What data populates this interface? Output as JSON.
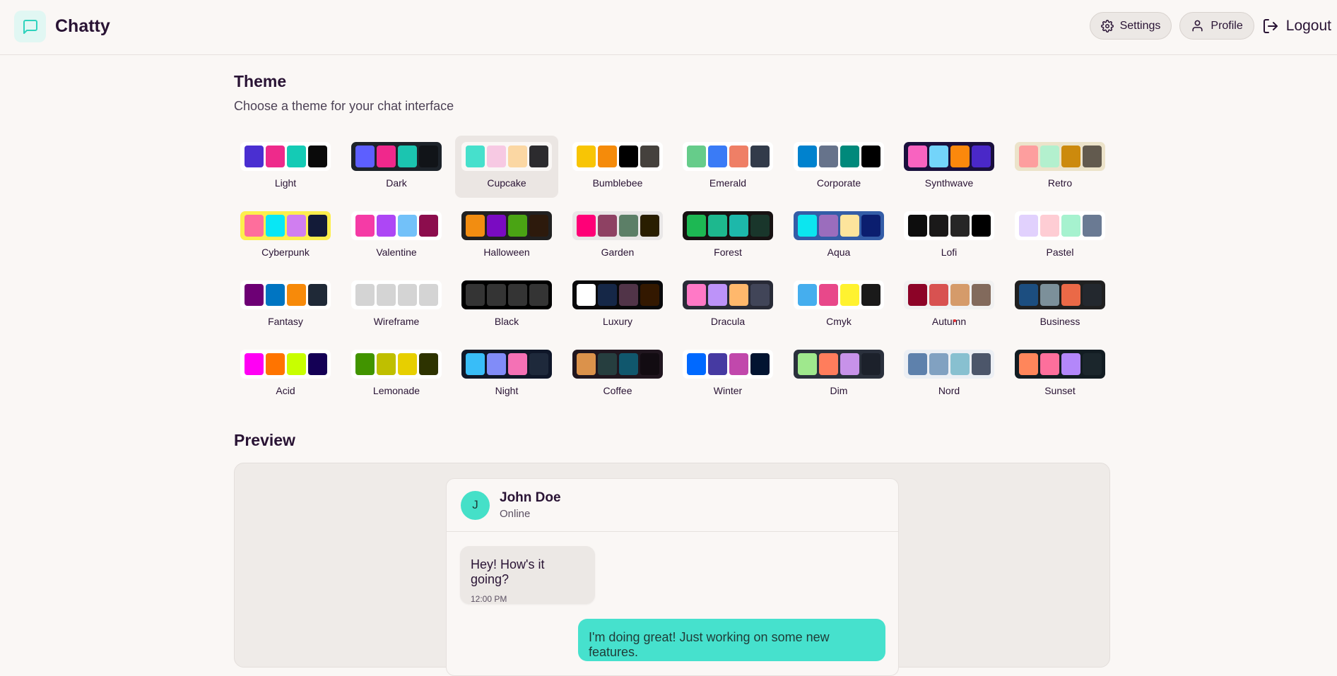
{
  "app": {
    "name": "Chatty"
  },
  "nav": {
    "settings": "Settings",
    "profile": "Profile",
    "logout": "Logout"
  },
  "theme_section": {
    "title": "Theme",
    "subtitle": "Choose a theme for your chat interface"
  },
  "selected_theme": "Cupcake",
  "themes": [
    {
      "name": "Light",
      "bg": "#ffffff",
      "colors": [
        "#4a2fd1",
        "#ee2a8b",
        "#14cbb5",
        "#0a0a0a"
      ]
    },
    {
      "name": "Dark",
      "bg": "#1d232a",
      "colors": [
        "#5d5fff",
        "#f0288c",
        "#1bc5b0",
        "#111418"
      ]
    },
    {
      "name": "Cupcake",
      "bg": "#faf7f5",
      "colors": [
        "#46e0cc",
        "#f7c9e3",
        "#fbd7a3",
        "#2c2b2e"
      ]
    },
    {
      "name": "Bumblebee",
      "bg": "#ffffff",
      "colors": [
        "#f8c505",
        "#f58b0a",
        "#000000",
        "#45413d"
      ]
    },
    {
      "name": "Emerald",
      "bg": "#ffffff",
      "colors": [
        "#66cc8a",
        "#3a7bf6",
        "#ef7f66",
        "#323b4a"
      ]
    },
    {
      "name": "Corporate",
      "bg": "#ffffff",
      "colors": [
        "#0082ce",
        "#66738b",
        "#00897b",
        "#000000"
      ]
    },
    {
      "name": "Synthwave",
      "bg": "#1a103d",
      "colors": [
        "#f863c0",
        "#73d4fa",
        "#fb880c",
        "#4a28c8"
      ]
    },
    {
      "name": "Retro",
      "bg": "#ece3ca",
      "colors": [
        "#fd9e9e",
        "#b3f0ce",
        "#cc8a0d",
        "#625a4e"
      ]
    },
    {
      "name": "Cyberpunk",
      "bg": "#fdef4c",
      "colors": [
        "#fe6e9c",
        "#08e7f5",
        "#d07ef0",
        "#131b38"
      ]
    },
    {
      "name": "Valentine",
      "bg": "#ffffff",
      "colors": [
        "#f53ba6",
        "#ad47f5",
        "#72c1f9",
        "#8c0d4d"
      ]
    },
    {
      "name": "Halloween",
      "bg": "#212121",
      "colors": [
        "#f28d11",
        "#7a0bc2",
        "#4aa414",
        "#2d1a0c"
      ]
    },
    {
      "name": "Garden",
      "bg": "#e9e7e7",
      "colors": [
        "#ff0077",
        "#8e4163",
        "#5c7f67",
        "#291e00"
      ]
    },
    {
      "name": "Forest",
      "bg": "#171212",
      "colors": [
        "#1db853",
        "#1db88e",
        "#1db8aa",
        "#19362b"
      ]
    },
    {
      "name": "Aqua",
      "bg": "#345da7",
      "colors": [
        "#0ce6ef",
        "#9b6dbd",
        "#fde49c",
        "#0b1e6f"
      ]
    },
    {
      "name": "Lofi",
      "bg": "#ffffff",
      "colors": [
        "#0d0d0d",
        "#1a1919",
        "#262626",
        "#000000"
      ]
    },
    {
      "name": "Pastel",
      "bg": "#ffffff",
      "colors": [
        "#e1d1fd",
        "#fecdd4",
        "#a6f2cf",
        "#6a7a93"
      ]
    },
    {
      "name": "Fantasy",
      "bg": "#ffffff",
      "colors": [
        "#6d0075",
        "#0075c2",
        "#f78a0a",
        "#1f2937"
      ]
    },
    {
      "name": "Wireframe",
      "bg": "#ffffff",
      "colors": [
        "#d4d4d4",
        "#d4d4d4",
        "#d4d4d4",
        "#d4d4d4"
      ]
    },
    {
      "name": "Black",
      "bg": "#000000",
      "colors": [
        "#343434",
        "#343434",
        "#343434",
        "#343434"
      ]
    },
    {
      "name": "Luxury",
      "bg": "#09090b",
      "colors": [
        "#ffffff",
        "#152747",
        "#513448",
        "#331800"
      ]
    },
    {
      "name": "Dracula",
      "bg": "#282a36",
      "colors": [
        "#ff79c6",
        "#bd93f9",
        "#ffb86c",
        "#414558"
      ]
    },
    {
      "name": "Cmyk",
      "bg": "#ffffff",
      "colors": [
        "#45aeee",
        "#e8488a",
        "#fff230",
        "#1a1a1a"
      ]
    },
    {
      "name": "Autumn",
      "bg": "#f1f1f1",
      "colors": [
        "#8c0327",
        "#d85251",
        "#d59b6a",
        "#826a5c"
      ]
    },
    {
      "name": "Business",
      "bg": "#202020",
      "colors": [
        "#1c4e80",
        "#7c909a",
        "#ea6947",
        "#23282e"
      ]
    },
    {
      "name": "Acid",
      "bg": "#ffffff",
      "colors": [
        "#ff00f4",
        "#ff7400",
        "#c8ff00",
        "#140055"
      ]
    },
    {
      "name": "Lemonade",
      "bg": "#ffffff",
      "colors": [
        "#419400",
        "#bfbf00",
        "#e7cf00",
        "#2d3300"
      ]
    },
    {
      "name": "Night",
      "bg": "#0f1729",
      "colors": [
        "#38bdf8",
        "#818cf8",
        "#f471b5",
        "#1e293b"
      ]
    },
    {
      "name": "Coffee",
      "bg": "#20161f",
      "colors": [
        "#db924b",
        "#263e3f",
        "#10576d",
        "#120c12"
      ]
    },
    {
      "name": "Winter",
      "bg": "#ffffff",
      "colors": [
        "#0069ff",
        "#463aa2",
        "#c148ac",
        "#021431"
      ]
    },
    {
      "name": "Dim",
      "bg": "#2a303c",
      "colors": [
        "#9fe88d",
        "#ff7d5c",
        "#c792e9",
        "#1c212b"
      ]
    },
    {
      "name": "Nord",
      "bg": "#eceff4",
      "colors": [
        "#5e81ac",
        "#81a1c1",
        "#88c0d0",
        "#4c566a"
      ]
    },
    {
      "name": "Sunset",
      "bg": "#121c22",
      "colors": [
        "#ff865b",
        "#fd6f9c",
        "#b387fa",
        "#1b262c"
      ]
    }
  ],
  "preview": {
    "title": "Preview",
    "contact": {
      "initial": "J",
      "name": "John Doe",
      "status": "Online"
    },
    "messages": [
      {
        "text": "Hey! How's it going?",
        "time": "12:00 PM",
        "sent": false
      },
      {
        "text": "I'm doing great! Just working on some new features.",
        "sent": true
      }
    ]
  },
  "colors": {
    "accent": "#46e1cd",
    "background": "#faf7f5",
    "text": "#291334"
  }
}
